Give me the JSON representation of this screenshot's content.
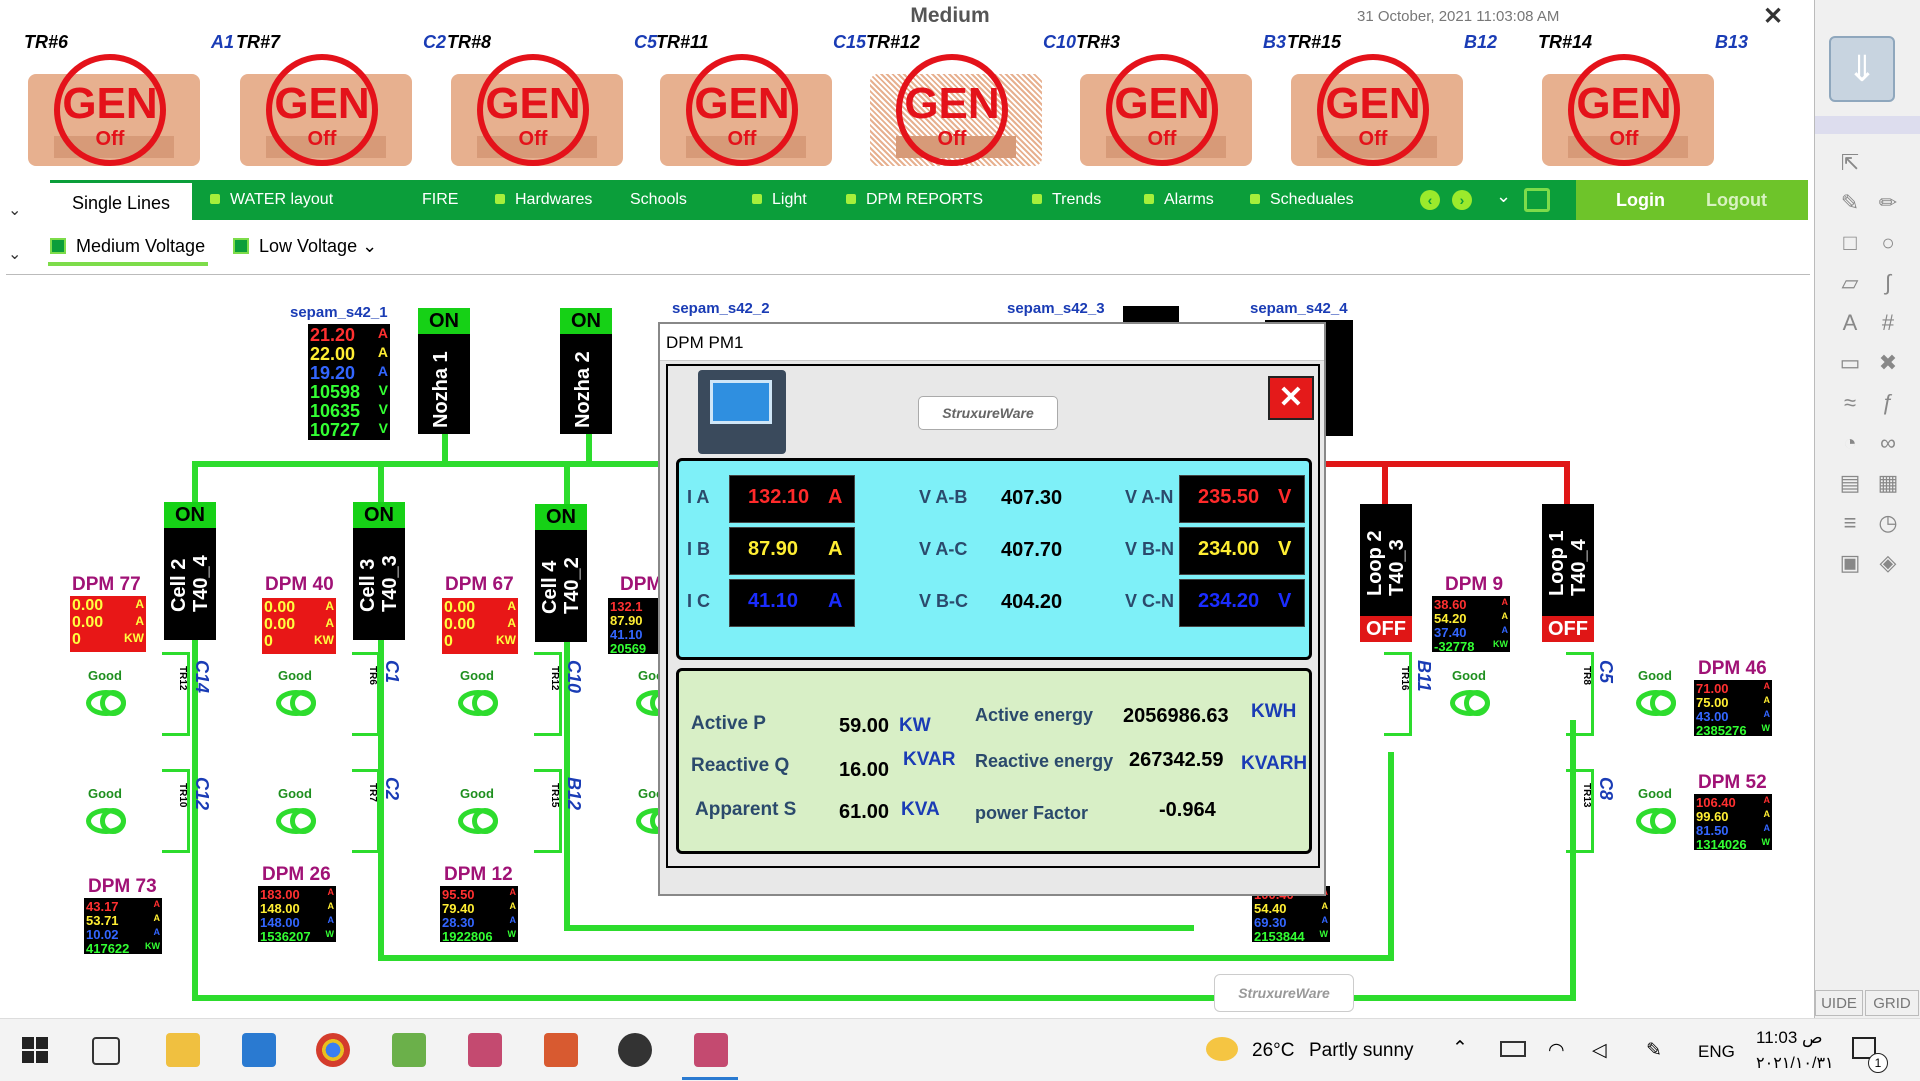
{
  "window": {
    "title": "Medium",
    "datetime": "31 October, 2021 11:03:08 AM",
    "close": "✕",
    "outer_close": "✕"
  },
  "generators": [
    {
      "tr": "TR#6",
      "code": "A1",
      "label": "GEN",
      "state": "Off"
    },
    {
      "tr": "TR#7",
      "code": "C2",
      "label": "GEN",
      "state": "Off"
    },
    {
      "tr": "TR#8",
      "code": "C5",
      "label": "GEN",
      "state": "Off"
    },
    {
      "tr": "TR#11",
      "code": "C15",
      "label": "GEN",
      "state": "Off"
    },
    {
      "tr": "TR#12",
      "code": "C10",
      "label": "GEN",
      "state": "Off"
    },
    {
      "tr": "TR#3",
      "code": "B3",
      "label": "GEN",
      "state": "Off"
    },
    {
      "tr": "TR#15",
      "code": "B12",
      "label": "GEN",
      "state": "Off"
    },
    {
      "tr": "TR#14",
      "code": "B13",
      "label": "GEN",
      "state": "Off"
    }
  ],
  "nav": {
    "single_lines": "Single Lines",
    "items": [
      "WATER layout",
      "FIRE",
      "Hardwares",
      "Schools",
      "Light",
      "DPM REPORTS",
      "Trends",
      "Alarms",
      "Scheduales"
    ],
    "login": "Login",
    "logout": "Logout"
  },
  "subtabs": {
    "medium": "Medium Voltage",
    "low": "Low Voltage"
  },
  "diagram": {
    "sepam1": {
      "name": "sepam_s42_1",
      "rows": [
        [
          "21.20",
          "A"
        ],
        [
          "22.00",
          "A"
        ],
        [
          "19.20",
          "A"
        ],
        [
          "10598",
          "V"
        ],
        [
          "10635",
          "V"
        ],
        [
          "10727",
          "V"
        ]
      ]
    },
    "sepam2": "sepam_s42_2",
    "sepam3": "sepam_s42_3",
    "sepam4": "sepam_s42_4",
    "nozha1": {
      "on": "ON",
      "name": "Nozha 1"
    },
    "nozha2": {
      "on": "ON",
      "name": "Nozha 2"
    },
    "cells": [
      {
        "on": "ON",
        "name": "Cell 2",
        "sub": "T40_4"
      },
      {
        "on": "ON",
        "name": "Cell 3",
        "sub": "T40_3"
      },
      {
        "on": "ON",
        "name": "Cell 4",
        "sub": "T40_2"
      }
    ],
    "loops": [
      {
        "off": "OFF",
        "name": "Loop 2",
        "sub": "T40_3"
      },
      {
        "off": "OFF",
        "name": "Loop 1",
        "sub": "T40_4"
      }
    ],
    "dpms": {
      "dpm77": {
        "title": "DPM 77",
        "rows": [
          [
            "0.00",
            "A"
          ],
          [
            "0.00",
            "A"
          ],
          [
            "0",
            "KW"
          ]
        ]
      },
      "dpm40": {
        "title": "DPM 40",
        "rows": [
          [
            "0.00",
            "A"
          ],
          [
            "0.00",
            "A"
          ],
          [
            "0",
            "KW"
          ]
        ]
      },
      "dpm67": {
        "title": "DPM 67",
        "rows": [
          [
            "0.00",
            "A"
          ],
          [
            "0.00",
            "A"
          ],
          [
            "0",
            "KW"
          ]
        ]
      },
      "dpmX": {
        "title": "DPM",
        "rows": [
          [
            "132.1",
            ""
          ],
          [
            "87.90",
            ""
          ],
          [
            "41.10",
            ""
          ],
          [
            "20569",
            ""
          ]
        ]
      },
      "dpm9": {
        "title": "DPM 9",
        "rows": [
          [
            "38.60",
            "A"
          ],
          [
            "54.20",
            "A"
          ],
          [
            "37.40",
            "A"
          ],
          [
            "-32778",
            "KW"
          ]
        ]
      },
      "dpm46": {
        "title": "DPM 46",
        "rows": [
          [
            "71.00",
            "A"
          ],
          [
            "75.00",
            "A"
          ],
          [
            "43.00",
            "A"
          ],
          [
            "2385276",
            "W"
          ]
        ]
      },
      "dpm52": {
        "title": "DPM 52",
        "rows": [
          [
            "106.40",
            "A"
          ],
          [
            "99.60",
            "A"
          ],
          [
            "81.50",
            "A"
          ],
          [
            "1314026",
            "W"
          ]
        ]
      },
      "dpm73": {
        "title": "DPM 73",
        "rows": [
          [
            "43.17",
            "A"
          ],
          [
            "53.71",
            "A"
          ],
          [
            "10.02",
            "A"
          ],
          [
            "417622",
            "KW"
          ]
        ]
      },
      "dpm26": {
        "title": "DPM 26",
        "rows": [
          [
            "183.00",
            "A"
          ],
          [
            "148.00",
            "A"
          ],
          [
            "148.00",
            "A"
          ],
          [
            "1536207",
            "W"
          ]
        ]
      },
      "dpm12": {
        "title": "DPM 12",
        "rows": [
          [
            "95.50",
            "A"
          ],
          [
            "79.40",
            "A"
          ],
          [
            "28.30",
            "A"
          ],
          [
            "1922806",
            "W"
          ]
        ]
      },
      "dpmB": {
        "title": "",
        "rows": [
          [
            "100.40",
            "A"
          ],
          [
            "54.40",
            "A"
          ],
          [
            "69.30",
            "A"
          ],
          [
            "2153844",
            "W"
          ]
        ]
      }
    },
    "good": "Good",
    "breakers": [
      {
        "code": "C14",
        "tr": "TR12"
      },
      {
        "code": "C1",
        "tr": "TR6"
      },
      {
        "code": "C10",
        "tr": "TR12"
      },
      {
        "code": "C12",
        "tr": "TR10"
      },
      {
        "code": "C2",
        "tr": "TR7"
      },
      {
        "code": "B12",
        "tr": "TR15"
      },
      {
        "code": "B11",
        "tr": "TR16"
      },
      {
        "code": "C5",
        "tr": "TR8"
      },
      {
        "code": "C8",
        "tr": "TR13"
      }
    ]
  },
  "popup": {
    "title": "DPM PM1",
    "brand": "StruxureWare",
    "close": "✕",
    "currents": [
      {
        "label": "I A",
        "value": "132.10",
        "unit": "A",
        "color": "#ff2a2a"
      },
      {
        "label": "I B",
        "value": "87.90",
        "unit": "A",
        "color": "#ffee33"
      },
      {
        "label": "I C",
        "value": "41.10",
        "unit": "A",
        "color": "#1a2cff"
      }
    ],
    "line_voltages": [
      {
        "label": "V A-B",
        "value": "407.30"
      },
      {
        "label": "V A-C",
        "value": "407.70"
      },
      {
        "label": "V B-C",
        "value": "404.20"
      }
    ],
    "phase_voltages": [
      {
        "label": "V A-N",
        "value": "235.50",
        "unit": "V",
        "color": "#ff2a2a"
      },
      {
        "label": "V B-N",
        "value": "234.00",
        "unit": "V",
        "color": "#ffee33"
      },
      {
        "label": "V C-N",
        "value": "234.20",
        "unit": "V",
        "color": "#1a2cff"
      }
    ],
    "power": {
      "active_label": "Active  P",
      "active_value": "59.00",
      "active_unit": "KW",
      "reactive_label": "Reactive Q",
      "reactive_value": "16.00",
      "reactive_unit": "KVAR",
      "apparent_label": "Apparent S",
      "apparent_value": "61.00",
      "apparent_unit": "KVA",
      "aenergy_label": "Active energy",
      "aenergy_value": "2056986.63",
      "aenergy_unit": "KWH",
      "renergy_label": "Reactive energy",
      "renergy_value": "267342.59",
      "renergy_unit": "KVARH",
      "pf_label": "power Factor",
      "pf_value": "-0.964"
    }
  },
  "toolbox": {
    "guide": "UIDE",
    "grid": "GRID"
  },
  "taskbar": {
    "weather_temp": "26°C",
    "weather_text": "Partly sunny",
    "lang": "ENG",
    "time": "11:03 ص",
    "date": "٢٠٢١/١٠/٣١",
    "notif_count": "1"
  },
  "colors": {
    "bus_green": "#2ddc2d",
    "bus_red": "#e01616",
    "nav_green": "#0b9e3a",
    "accent_red": "#e4121a"
  }
}
